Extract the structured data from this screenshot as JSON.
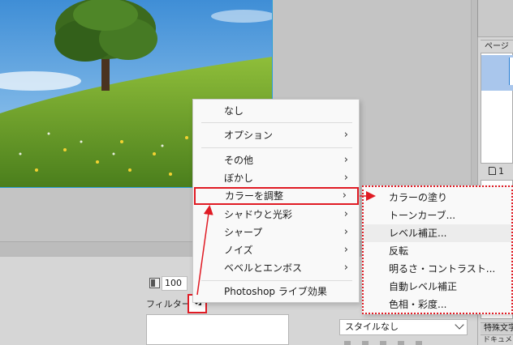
{
  "properties": {
    "opacity_value": "100",
    "filter_label": "フィルター：",
    "style_select_value": "スタイルなし"
  },
  "pages_panel": {
    "tab_label": "ページ",
    "page_count": "1",
    "special_char_tab": "特殊文字",
    "document_tab": "ドキュメ"
  },
  "context_menu": {
    "items": [
      {
        "label": "なし",
        "has_submenu": false
      },
      {
        "label": "オプション",
        "has_submenu": true
      },
      {
        "label": "その他",
        "has_submenu": true
      },
      {
        "label": "ぼかし",
        "has_submenu": true
      },
      {
        "label": "カラーを調整",
        "has_submenu": true,
        "highlighted": true
      },
      {
        "label": "シャドウと光彩",
        "has_submenu": true
      },
      {
        "label": "シャープ",
        "has_submenu": true
      },
      {
        "label": "ノイズ",
        "has_submenu": true
      },
      {
        "label": "ベベルとエンボス",
        "has_submenu": true
      },
      {
        "label": "Photoshop ライブ効果",
        "has_submenu": false
      }
    ],
    "submenu_glyph": "›"
  },
  "submenu": {
    "items": [
      {
        "label": "カラーの塗り"
      },
      {
        "label": "トーンカーブ..."
      },
      {
        "label": "レベル補正...",
        "hovered": true
      },
      {
        "label": "反転"
      },
      {
        "label": "明るさ・コントラスト..."
      },
      {
        "label": "自動レベル補正"
      },
      {
        "label": "色相・彩度..."
      }
    ]
  },
  "colors": {
    "annotation_red": "#e01b24",
    "selection_blue": "#2a9fd6"
  },
  "icons": {
    "filter_add": "filter-add-triangle-icon",
    "opacity": "opacity-icon",
    "document": "document-icon"
  }
}
